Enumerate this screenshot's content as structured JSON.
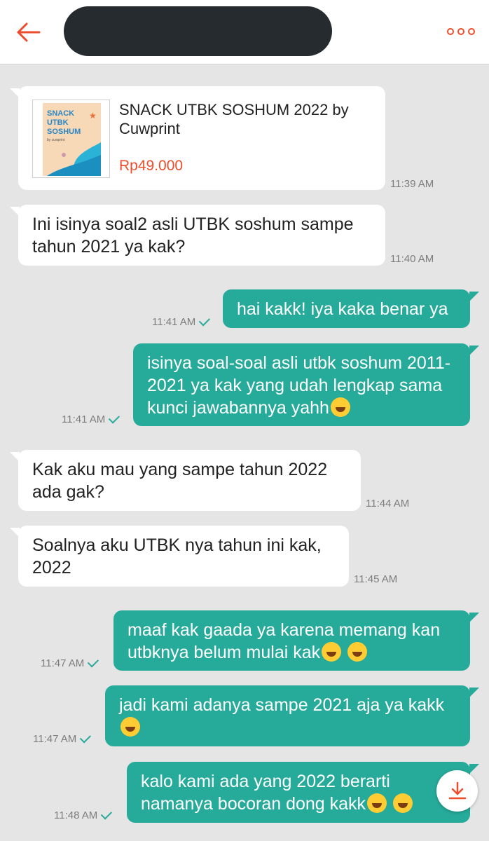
{
  "header": {
    "back_icon": "arrow-left-icon",
    "more_icon": "more-dots-icon",
    "accent": "#ee4d2d"
  },
  "product": {
    "name": "SNACK UTBK SOSHUM 2022 by Cuwprint",
    "price": "Rp49.000",
    "thumb_text": "SNACK UTBK SOSHUM",
    "thumb_subtext": "by cuwprint",
    "time": "11:39 AM"
  },
  "messages": [
    {
      "side": "in",
      "text": "Ini isinya soal2 asli UTBK soshum sampe tahun 2021 ya kak?",
      "time": "11:40 AM"
    },
    {
      "side": "out",
      "text": "hai kakk! iya kaka benar ya",
      "time": "11:41 AM"
    },
    {
      "side": "out",
      "text": "isinya soal-soal asli utbk soshum 2011-2021 ya kak yang udah lengkap sama kunci jawabannya yahh",
      "time": "11:41 AM"
    },
    {
      "side": "in",
      "text": "Kak aku mau yang sampe tahun 2022 ada gak?",
      "time": "11:44 AM"
    },
    {
      "side": "in",
      "text": "Soalnya aku UTBK nya tahun ini kak, 2022",
      "time": "11:45 AM"
    },
    {
      "side": "out",
      "text": "maaf kak gaada ya karena memang kan utbknya belum mulai kak",
      "time": "11:47 AM"
    },
    {
      "side": "out",
      "text": "jadi kami adanya sampe 2021 aja ya kakk",
      "time": "11:47 AM"
    },
    {
      "side": "out",
      "text": "kalo kami ada yang 2022 berarti namanya bocoran dong kakk",
      "time": "11:48 AM"
    }
  ],
  "colors": {
    "outgoing_bubble": "#26aa99",
    "incoming_bubble": "#ffffff",
    "background": "#e5e5e5"
  },
  "scroll_icon": "download-arrow-icon"
}
